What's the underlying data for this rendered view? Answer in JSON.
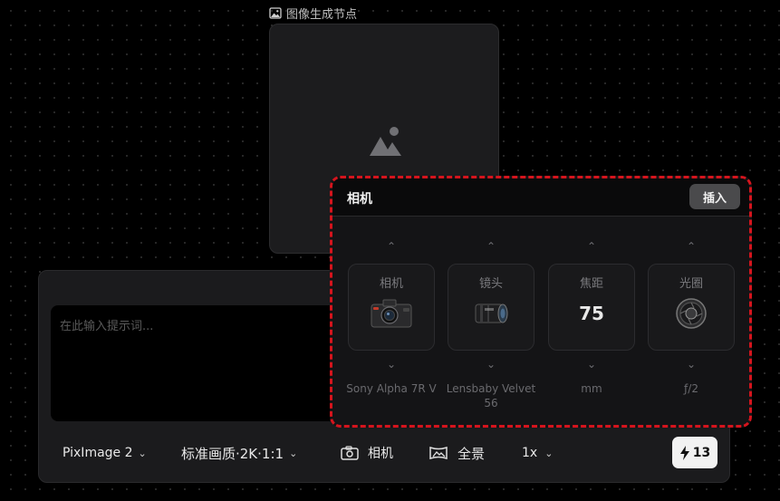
{
  "node": {
    "title": "图像生成节点",
    "icon": "image-icon"
  },
  "prompt": {
    "placeholder": "在此输入提示词..."
  },
  "toolbar": {
    "model": "PixImage 2",
    "quality": "标准画质·2K·1:1",
    "camera": "相机",
    "panorama": "全景",
    "count": "1x",
    "credits": "13"
  },
  "camera_panel": {
    "title": "相机",
    "insert_label": "插入",
    "params": [
      {
        "label": "相机",
        "visual": "camera-body-icon",
        "caption": "Sony Alpha 7R V"
      },
      {
        "label": "镜头",
        "visual": "lens-icon",
        "caption": "Lensbaby Velvet 56"
      },
      {
        "label": "焦距",
        "value": "75",
        "caption": "mm"
      },
      {
        "label": "光圈",
        "visual": "aperture-icon",
        "caption": "ƒ/2"
      }
    ]
  },
  "colors": {
    "accent_border": "#d5141d",
    "credit_bg": "#f2f2f2"
  }
}
